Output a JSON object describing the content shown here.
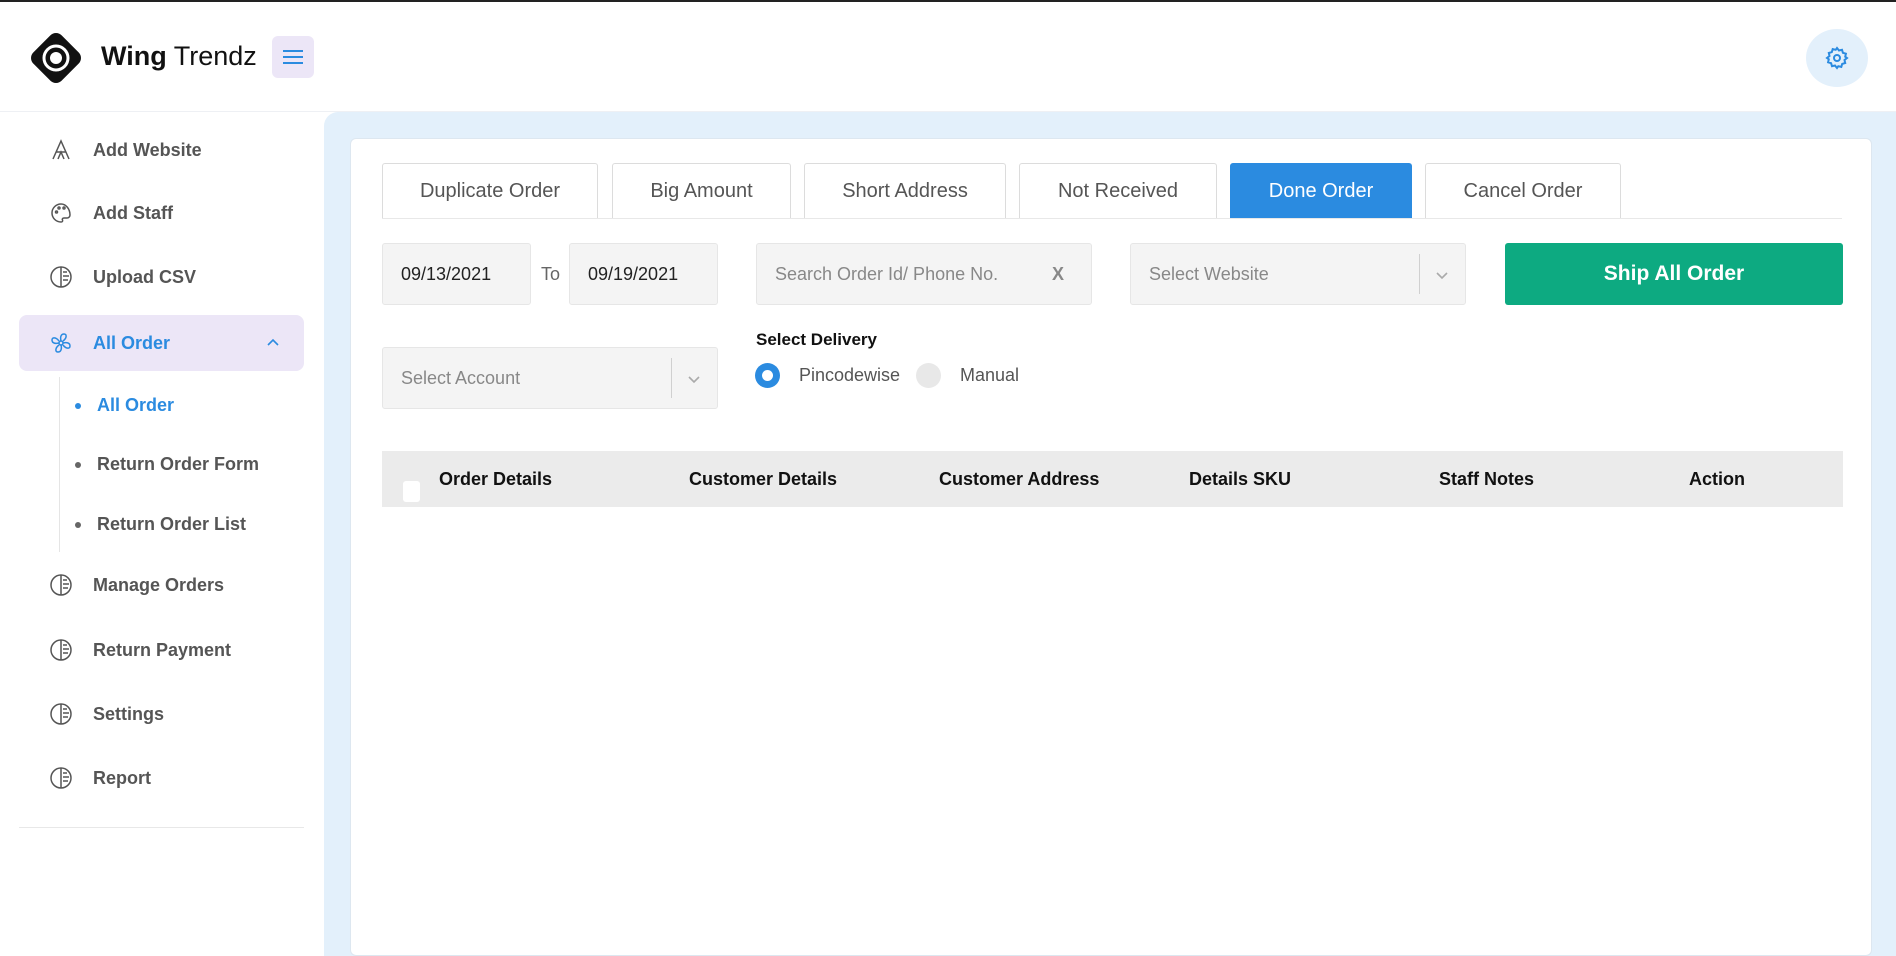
{
  "brand": {
    "bold": "Wing",
    "regular": " Trendz"
  },
  "sidebar": {
    "items": [
      {
        "label": "Add Website",
        "icon": "font-a-icon"
      },
      {
        "label": "Add Staff",
        "icon": "palette-icon"
      },
      {
        "label": "Upload CSV",
        "icon": "circle-lines-icon"
      },
      {
        "label": "All Order",
        "icon": "fan-icon",
        "active": true
      },
      {
        "label": "Manage Orders",
        "icon": "circle-lines-icon"
      },
      {
        "label": "Return Payment",
        "icon": "circle-lines-icon"
      },
      {
        "label": "Settings",
        "icon": "circle-lines-icon"
      },
      {
        "label": "Report",
        "icon": "circle-lines-icon"
      }
    ],
    "sub_items": [
      {
        "label": "All Order",
        "active": true
      },
      {
        "label": "Return Order Form"
      },
      {
        "label": "Return Order List"
      }
    ]
  },
  "tabs": [
    {
      "label": "Duplicate Order"
    },
    {
      "label": "Big Amount"
    },
    {
      "label": "Short Address"
    },
    {
      "label": "Not Received"
    },
    {
      "label": "Done Order",
      "active": true
    },
    {
      "label": "Cancel Order"
    }
  ],
  "filters": {
    "date_from": "09/13/2021",
    "to_label": "To",
    "date_to": "09/19/2021",
    "search_placeholder": "Search Order Id/ Phone No.",
    "search_clear": "X",
    "website_placeholder": "Select Website",
    "account_placeholder": "Select Account",
    "ship_all_label": "Ship All Order"
  },
  "delivery": {
    "label": "Select Delivery",
    "options": [
      {
        "label": "Pincodewise",
        "selected": true
      },
      {
        "label": "Manual",
        "selected": false
      }
    ]
  },
  "table": {
    "columns": [
      "Order Details",
      "Customer Details",
      "Customer Address",
      "Details SKU",
      "Staff Notes",
      "Action"
    ]
  },
  "colors": {
    "accent": "#2b8be0",
    "ship_button": "#0daa81",
    "main_background": "#e3f0fb",
    "active_sidebar": "#ece6f7"
  }
}
